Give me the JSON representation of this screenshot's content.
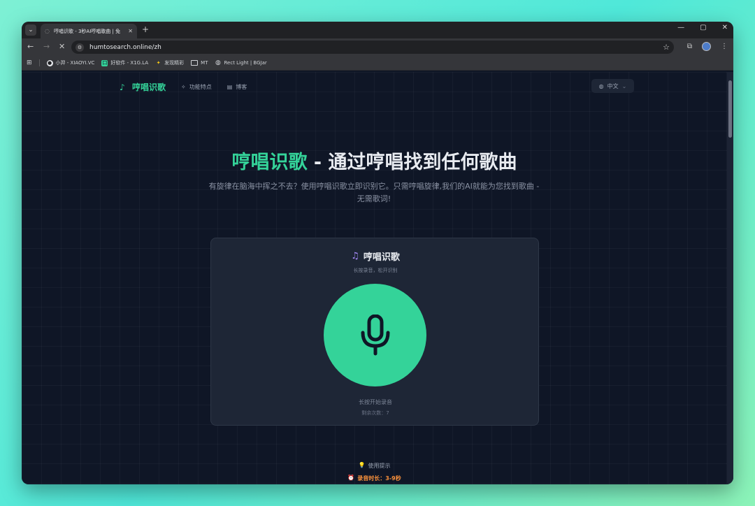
{
  "browser": {
    "tab_title": "哼唱识歌 - 3秒AI哼唱歌曲 | 免",
    "url": "humtosearch.online/zh",
    "bookmarks": [
      {
        "label": "小羿 - XIAOYI.VC",
        "icon": "github-icon",
        "color": "#e8eaed"
      },
      {
        "label": "好软件 - X1G.LA",
        "icon": "app-icon",
        "color": "#34d399"
      },
      {
        "label": "发现精彩",
        "icon": "spark-icon",
        "color": "#facc15"
      },
      {
        "label": "MT",
        "icon": "folder-icon",
        "color": "#cfd2d6"
      },
      {
        "label": "Rect Light | BGJar",
        "icon": "globe-icon",
        "color": "#cfd2d6"
      }
    ]
  },
  "nav": {
    "logo": "哼唱识歌",
    "features": "功能特点",
    "blog": "博客",
    "language": "中文"
  },
  "hero": {
    "title_accent": "哼唱识歌",
    "title_rest": " - 通过哼唱找到任何歌曲",
    "subtitle": "有旋律在脑海中挥之不去？使用哼唱识歌立即识别它。只需哼唱旋律,我们的AI就能为您找到歌曲 - 无需歌词!"
  },
  "card": {
    "title": "哼唱识歌",
    "hint": "长按录音，松开识别",
    "start_label": "长按开始录音",
    "remaining": "剩余次数：7"
  },
  "tips": {
    "label": "使用提示",
    "duration": "录音时长：3-9秒"
  },
  "colors": {
    "accent": "#34d399",
    "background": "#0f1626",
    "card": "#1e2636",
    "warning": "#fb923c"
  }
}
